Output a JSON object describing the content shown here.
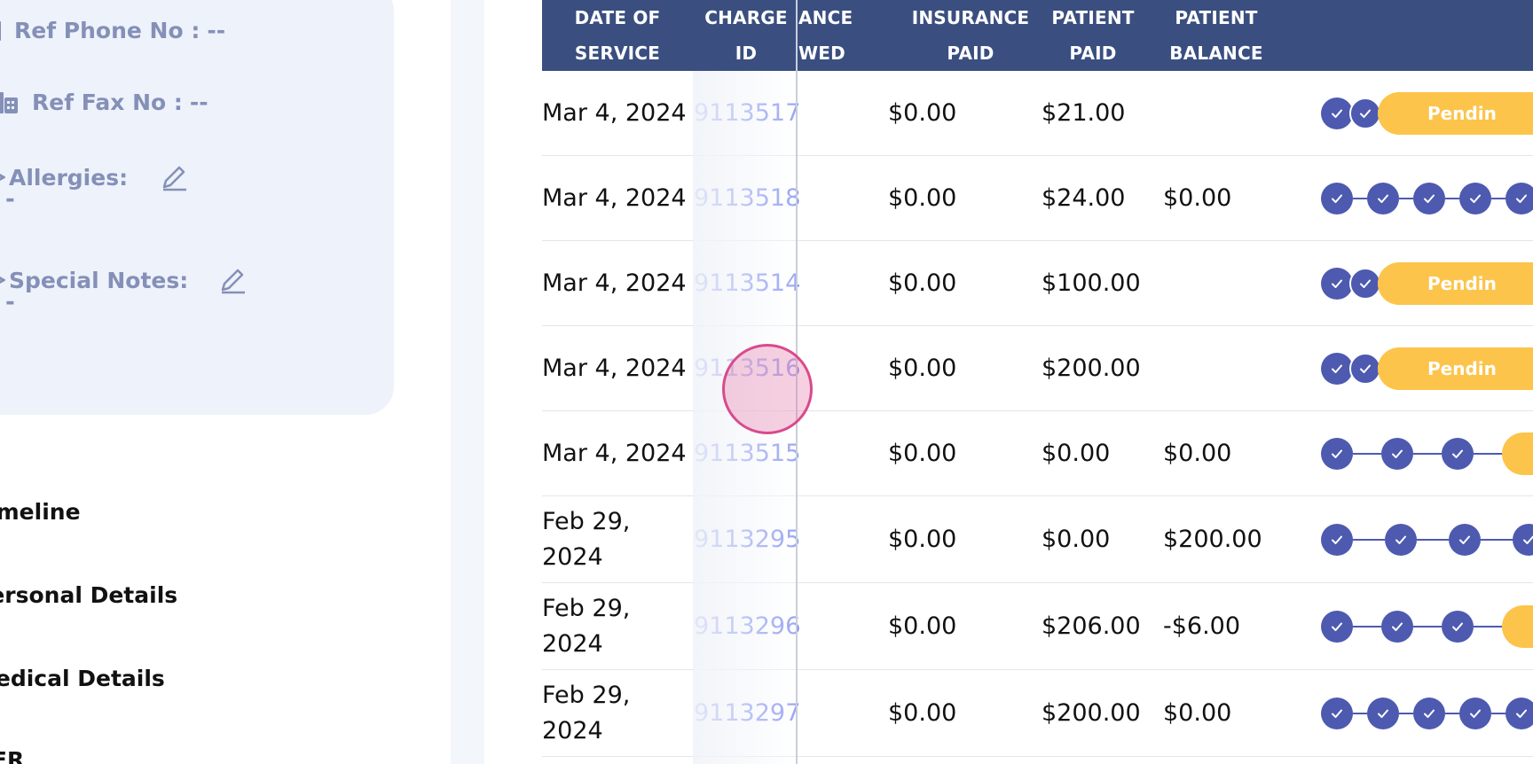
{
  "patient_info": {
    "ref_phone": {
      "label": "Ref Phone No :",
      "value": "--"
    },
    "ref_fax": {
      "label": "Ref Fax No :",
      "value": "--"
    },
    "allergies": {
      "label": "Allergies:",
      "value": "-"
    },
    "special_notes": {
      "label": "Special Notes:",
      "value": "-"
    }
  },
  "nav": [
    "Timeline",
    "Personal Details",
    "Medical Details",
    "HER"
  ],
  "table": {
    "headers": {
      "date_of_service": [
        "DATE OF",
        "SERVICE"
      ],
      "charge_id": [
        "CHARGE",
        "ID"
      ],
      "insurance_allowed": [
        "ANCE",
        "WED"
      ],
      "insurance_paid": [
        "INSURANCE",
        "PAID"
      ],
      "patient_paid": [
        "PATIENT",
        "PAID"
      ],
      "patient_balance": [
        "PATIENT",
        "BALANCE"
      ]
    },
    "rows": [
      {
        "date": "Mar 4, 2024",
        "charge_id": "9113517",
        "insurance_paid": "$0.00",
        "patient_paid": "$21.00",
        "patient_balance": "",
        "status_type": "pending",
        "status_label": "Pendin"
      },
      {
        "date": "Mar 4, 2024",
        "charge_id": "9113518",
        "insurance_paid": "$0.00",
        "patient_paid": "$24.00",
        "patient_balance": "$0.00",
        "status_type": "complete",
        "status_label": ""
      },
      {
        "date": "Mar 4, 2024",
        "charge_id": "9113514",
        "insurance_paid": "$0.00",
        "patient_paid": "$100.00",
        "patient_balance": "",
        "status_type": "pending",
        "status_label": "Pendin"
      },
      {
        "date": "Mar 4, 2024",
        "charge_id": "9113516",
        "insurance_paid": "$0.00",
        "patient_paid": "$200.00",
        "patient_balance": "",
        "status_type": "pending",
        "status_label": "Pendin"
      },
      {
        "date": "Mar 4, 2024",
        "charge_id": "9113515",
        "insurance_paid": "$0.00",
        "patient_paid": "$0.00",
        "patient_balance": "$0.00",
        "status_type": "progress",
        "status_label": ""
      },
      {
        "date": "Feb 29, 2024",
        "charge_id": "9113295",
        "insurance_paid": "$0.00",
        "patient_paid": "$0.00",
        "patient_balance": "$200.00",
        "status_type": "progress4",
        "status_label": ""
      },
      {
        "date": "Feb 29, 2024",
        "charge_id": "9113296",
        "insurance_paid": "$0.00",
        "patient_paid": "$206.00",
        "patient_balance": "-$6.00",
        "status_type": "progress",
        "status_label": ""
      },
      {
        "date": "Feb 29, 2024",
        "charge_id": "9113297",
        "insurance_paid": "$0.00",
        "patient_paid": "$200.00",
        "patient_balance": "$0.00",
        "status_type": "complete",
        "status_label": ""
      }
    ]
  },
  "colors": {
    "header_bg": "#3a4f80",
    "link": "#6f7ff0",
    "step": "#4d5ab0",
    "pending": "#fcc44a",
    "panel_bg": "#eef2fa"
  },
  "icons": {
    "phone": "phone-icon",
    "fax": "fax-icon",
    "edit": "pencil-icon",
    "check": "check-icon"
  }
}
